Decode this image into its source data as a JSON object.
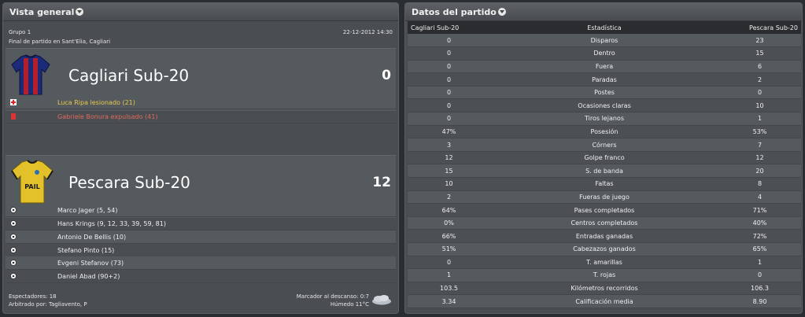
{
  "overview": {
    "title": "Vista general",
    "group": "Grupo 1",
    "datetime": "22-12-2012 14:30",
    "venue": "Final de partido en Sant'Elia, Cagliari",
    "home": {
      "name": "Cagliari Sub-20",
      "score": "0",
      "shirt_colors": [
        "#1c2a7a",
        "#b3202b"
      ],
      "events": [
        {
          "icon": "injury-icon",
          "text": "Luca Ripa lesionado (21)",
          "color": "#e8c94a"
        },
        {
          "icon": "red-card-icon",
          "text": "Gabriele Bonura expulsado (41)",
          "color": "#e06a5a"
        }
      ]
    },
    "away": {
      "name": "Pescara Sub-20",
      "score": "12",
      "shirt_text": "PAIL",
      "shirt_colors": [
        "#e3c12a",
        "#1a1a1a"
      ],
      "scorers": [
        {
          "icon": "ball-icon",
          "text": "Marco Jager (5, 54)"
        },
        {
          "icon": "ball-icon",
          "text": "Hans Krings (9, 12, 33, 39, 59, 81)"
        },
        {
          "icon": "ball-icon",
          "text": "Antonio De Bellis (10)"
        },
        {
          "icon": "ball-icon",
          "text": "Stefano Pinto (15)"
        },
        {
          "icon": "ball-icon",
          "text": "Evgeni Stefanov (73)"
        },
        {
          "icon": "ball-icon",
          "text": "Daniel Abad (90+2)"
        }
      ]
    },
    "footer": {
      "spectators": "Espectadores: 18",
      "referee": "Arbitrado por: Tagliavento, P",
      "halftime": "Marcador al descanso: 0:7",
      "weather": "Húmedo 11°C",
      "weather_icon": "cloud-icon"
    }
  },
  "stats": {
    "title": "Datos del partido",
    "headers": {
      "home": "Cagliari Sub-20",
      "stat": "Estadística",
      "away": "Pescara Sub-20"
    },
    "rows": [
      {
        "home": "0",
        "stat": "Disparos",
        "away": "23"
      },
      {
        "home": "0",
        "stat": "Dentro",
        "away": "15"
      },
      {
        "home": "0",
        "stat": "Fuera",
        "away": "6"
      },
      {
        "home": "0",
        "stat": "Paradas",
        "away": "2"
      },
      {
        "home": "0",
        "stat": "Postes",
        "away": "0"
      },
      {
        "home": "0",
        "stat": "Ocasiones claras",
        "away": "10"
      },
      {
        "home": "0",
        "stat": "Tiros lejanos",
        "away": "1"
      },
      {
        "home": "47%",
        "stat": "Posesión",
        "away": "53%"
      },
      {
        "home": "3",
        "stat": "Córners",
        "away": "7"
      },
      {
        "home": "12",
        "stat": "Golpe franco",
        "away": "12"
      },
      {
        "home": "15",
        "stat": "S. de banda",
        "away": "20"
      },
      {
        "home": "10",
        "stat": "Faltas",
        "away": "8"
      },
      {
        "home": "2",
        "stat": "Fueras de juego",
        "away": "4"
      },
      {
        "home": "64%",
        "stat": "Pases completados",
        "away": "71%"
      },
      {
        "home": "0%",
        "stat": "Centros completados",
        "away": "40%"
      },
      {
        "home": "66%",
        "stat": "Entradas ganadas",
        "away": "72%"
      },
      {
        "home": "51%",
        "stat": "Cabezazos ganados",
        "away": "65%"
      },
      {
        "home": "0",
        "stat": "T. amarillas",
        "away": "1"
      },
      {
        "home": "1",
        "stat": "T. rojas",
        "away": "0"
      },
      {
        "home": "103.5",
        "stat": "Kilómetros recorridos",
        "away": "106.3"
      },
      {
        "home": "3.34",
        "stat": "Calificación media",
        "away": "8.90"
      }
    ]
  }
}
